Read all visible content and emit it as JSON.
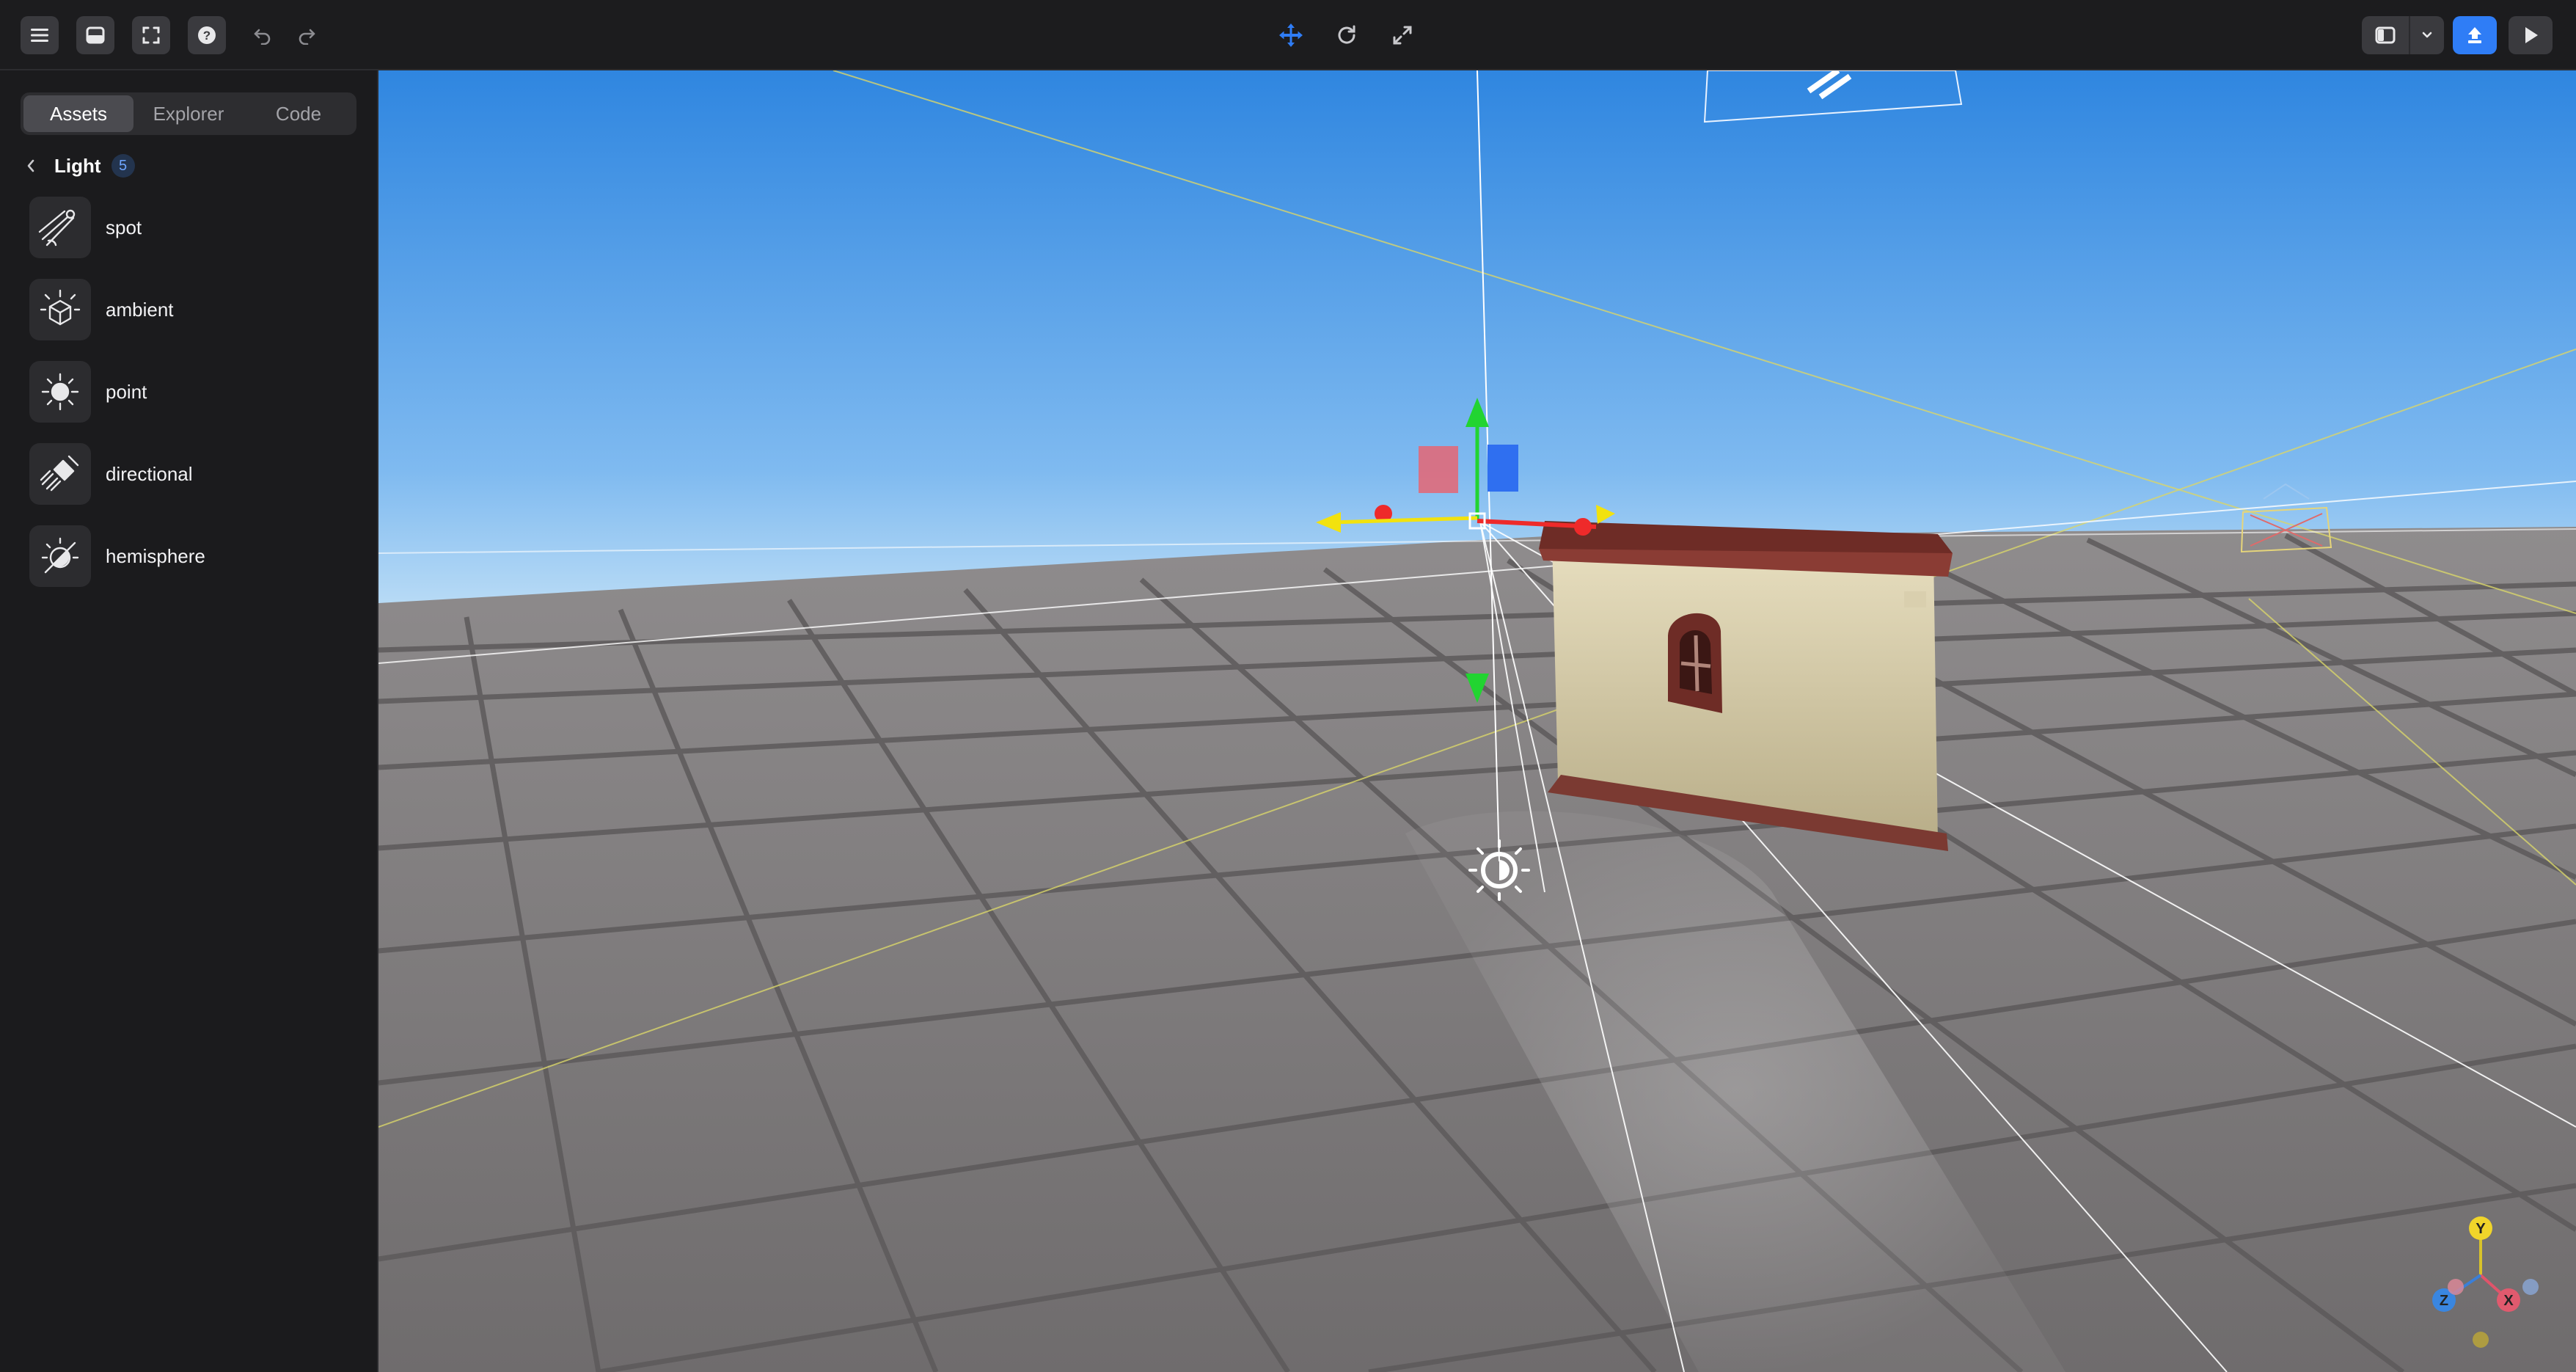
{
  "sidebar": {
    "tabs": [
      {
        "label": "Assets"
      },
      {
        "label": "Explorer"
      },
      {
        "label": "Code"
      }
    ],
    "category": {
      "title": "Light",
      "count": "5"
    },
    "items": [
      {
        "label": "spot",
        "icon": "spot-light-icon"
      },
      {
        "label": "ambient",
        "icon": "ambient-light-icon"
      },
      {
        "label": "point",
        "icon": "point-light-icon"
      },
      {
        "label": "directional",
        "icon": "directional-light-icon"
      },
      {
        "label": "hemisphere",
        "icon": "hemisphere-light-icon"
      }
    ]
  },
  "toolbar": {
    "left_icons": [
      "menu-icon",
      "inbox-icon",
      "fullscreen-icon",
      "help-icon",
      "undo-icon",
      "redo-icon"
    ],
    "center_icons": [
      "move-icon",
      "rotate-icon",
      "scale-icon"
    ],
    "right_icons": [
      "layout-icon",
      "chevron-down-icon",
      "upload-icon",
      "play-icon"
    ],
    "accent": "#2f7df6"
  },
  "viewport": {
    "sky_top": "#2f86e0",
    "sky_bottom": "#bfe0f6",
    "floor": "#7d7a7b",
    "gizmo_axes": {
      "x": "Y",
      "y": "X",
      "z": "Z"
    }
  }
}
